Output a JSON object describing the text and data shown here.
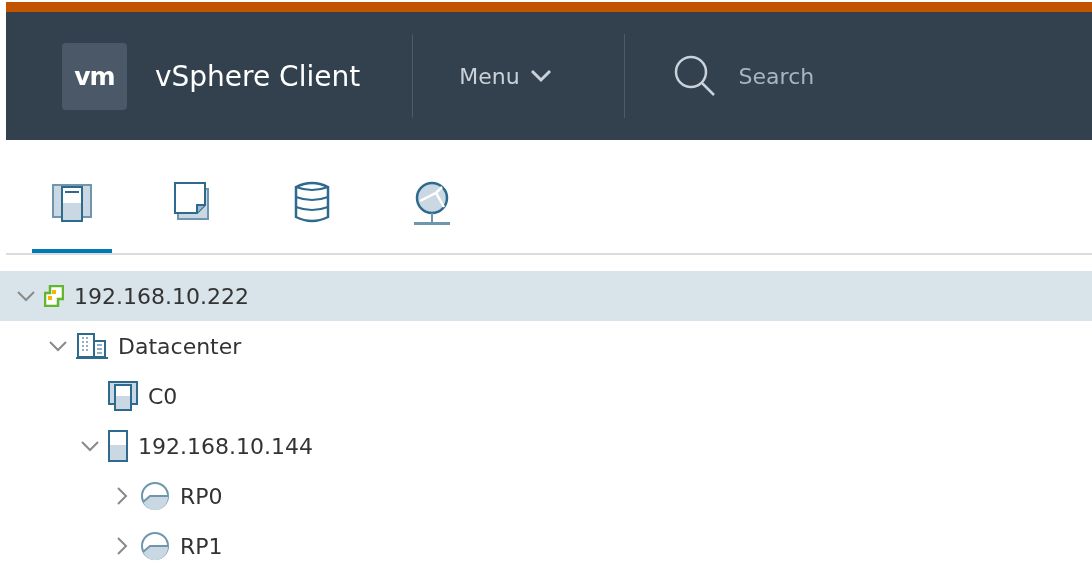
{
  "header": {
    "logo": "vm",
    "title": "vSphere Client",
    "menu": "Menu",
    "search": {
      "placeholder": "Search"
    }
  },
  "tabs": [
    {
      "kind": "hosts",
      "selected": true
    },
    {
      "kind": "vms",
      "selected": false
    },
    {
      "kind": "storage",
      "selected": false
    },
    {
      "kind": "network",
      "selected": false
    }
  ],
  "tree": [
    {
      "label": "192.168.10.222",
      "kind": "vcenter",
      "expandable": true,
      "expanded": true,
      "selected": true,
      "children": [
        {
          "label": "Datacenter",
          "kind": "datacenter",
          "expandable": true,
          "expanded": true,
          "selected": false,
          "children": [
            {
              "label": "C0",
              "kind": "cluster",
              "expandable": false,
              "selected": false
            },
            {
              "label": "192.168.10.144",
              "kind": "host",
              "expandable": true,
              "expanded": true,
              "selected": false,
              "children": [
                {
                  "label": "RP0",
                  "kind": "pool",
                  "expandable": true,
                  "expanded": false,
                  "selected": false
                },
                {
                  "label": "RP1",
                  "kind": "pool",
                  "expandable": true,
                  "expanded": false,
                  "selected": false
                }
              ]
            }
          ]
        }
      ]
    }
  ]
}
